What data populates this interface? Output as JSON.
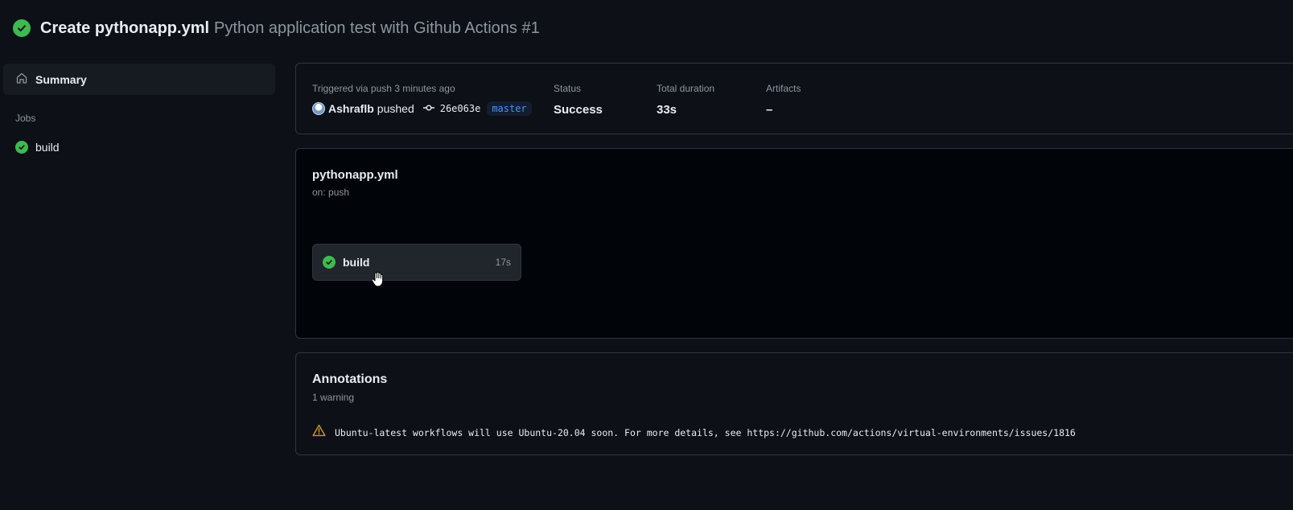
{
  "header": {
    "title": "Create pythonapp.yml",
    "subtitle": "Python application test with Github Actions #1",
    "status_icon": "check-circle-icon"
  },
  "sidebar": {
    "summary_label": "Summary",
    "jobs_heading": "Jobs",
    "jobs": [
      {
        "label": "build",
        "status": "success"
      }
    ]
  },
  "run_info": {
    "trigger_label": "Triggered via push 3 minutes ago",
    "actor": "Ashraflb",
    "action": "pushed",
    "commit": "26e063e",
    "branch": "master",
    "status_label": "Status",
    "status_value": "Success",
    "duration_label": "Total duration",
    "duration_value": "33s",
    "artifacts_label": "Artifacts",
    "artifacts_value": "–"
  },
  "workflow": {
    "file": "pythonapp.yml",
    "trigger": "on: push",
    "jobs": [
      {
        "name": "build",
        "duration": "17s",
        "status": "success"
      }
    ]
  },
  "annotations": {
    "title": "Annotations",
    "count": "1 warning",
    "items": [
      {
        "level": "warning",
        "message": "Ubuntu-latest workflows will use Ubuntu-20.04 soon. For more details, see https://github.com/actions/virtual-environments/issues/1816"
      }
    ]
  },
  "colors": {
    "background": "#0d1117",
    "success": "#3fb950",
    "warning": "#d29922",
    "link": "#4493f8",
    "muted_text": "#8d96a0"
  }
}
